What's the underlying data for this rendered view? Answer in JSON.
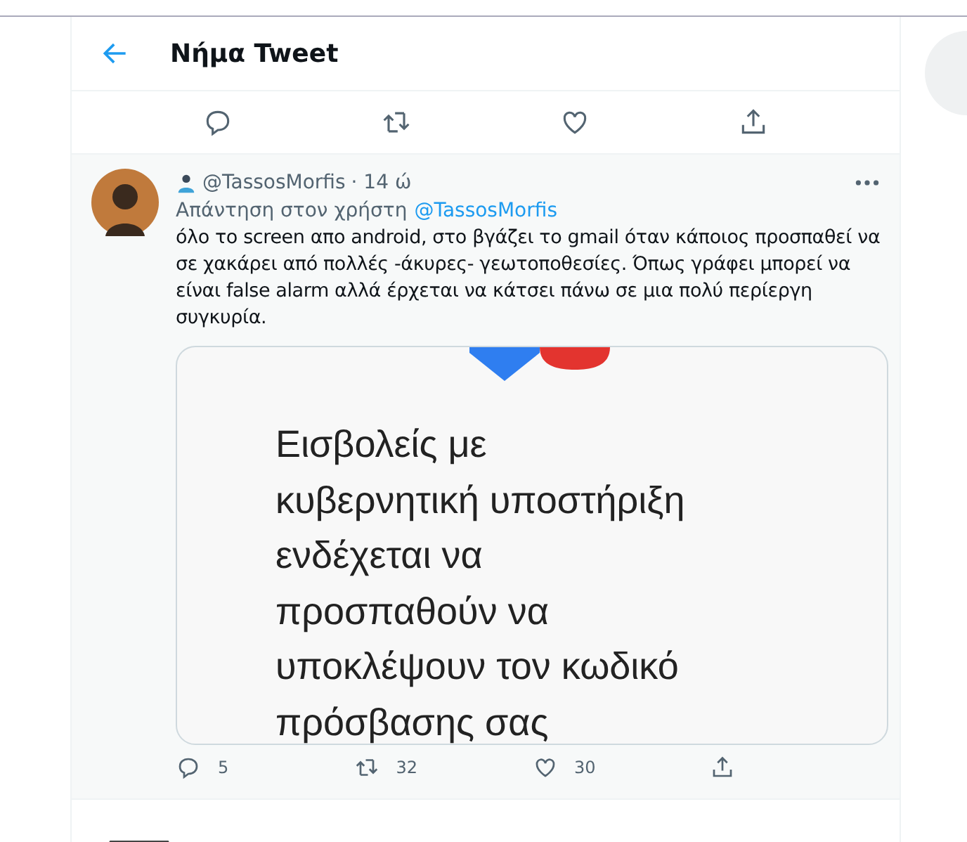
{
  "header": {
    "title": "Νήμα Tweet"
  },
  "top_actions": [
    {
      "kind": "reply"
    },
    {
      "kind": "retweet"
    },
    {
      "kind": "like"
    },
    {
      "kind": "share"
    }
  ],
  "tweet": {
    "handle": "@TassosMorfis",
    "time": "· 14 ώ",
    "reply_to": "Απάντηση στον χρήστη",
    "reply_handle": "@TassosMorfis",
    "text": "όλο το screen απο android, στο βγάζει το gmail όταν κάποιος προσπαθεί να σε χακάρει από πολλές -άκυρες- γεωτοποθεσίες. Όπως γράφει μπορεί να είναι false alarm αλλά έρχεται να κάτσει πάνω σε μια πολύ περίεργη συγκυρία.",
    "image_lines": [
      "Εισβολείς με",
      "κυβερνητική υποστήριξη",
      "ενδέχεται να",
      "προσπαθούν να",
      "υποκλέψουν τον κωδικό",
      "πρόσβασης σας"
    ],
    "actions": [
      {
        "kind": "reply",
        "count": "5"
      },
      {
        "kind": "retweet",
        "count": "32"
      },
      {
        "kind": "like",
        "count": "30"
      },
      {
        "kind": "share"
      }
    ]
  }
}
